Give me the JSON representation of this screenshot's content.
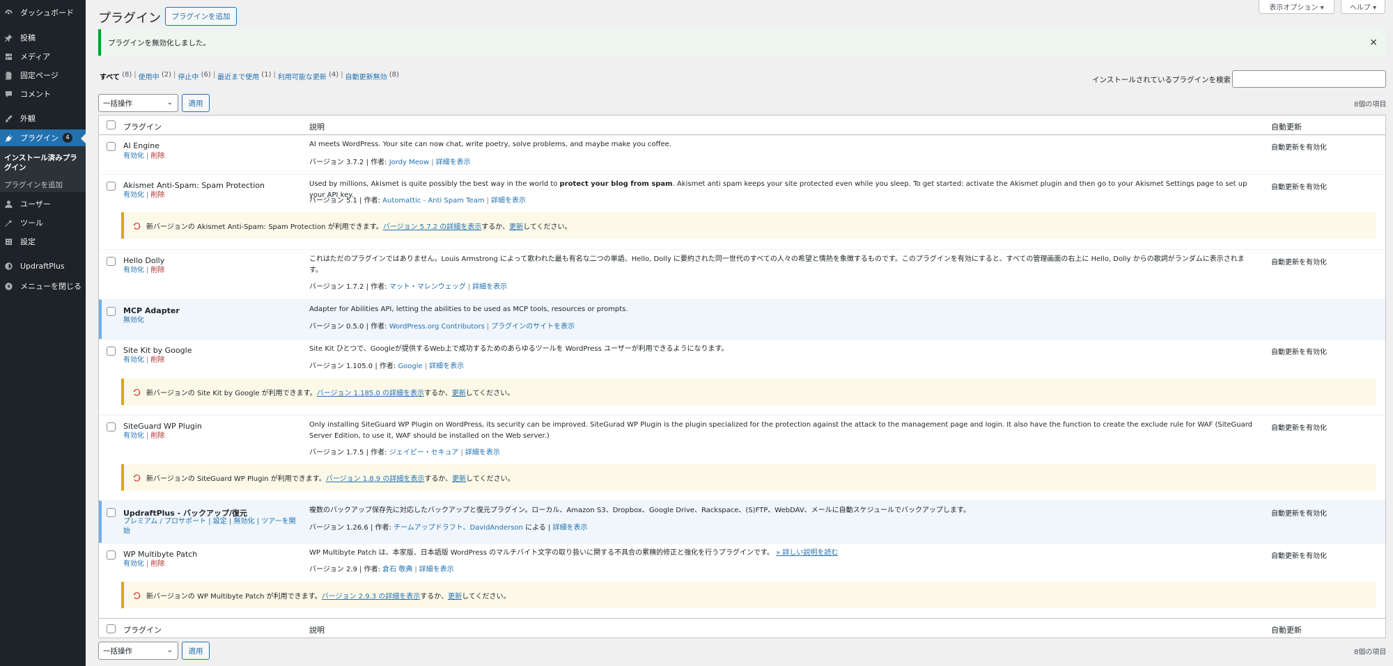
{
  "sidebar": {
    "items": [
      {
        "label": "ダッシュボード",
        "icon": "dashboard-icon"
      },
      {
        "label": "投稿",
        "icon": "pin-icon"
      },
      {
        "label": "メディア",
        "icon": "media-icon"
      },
      {
        "label": "固定ページ",
        "icon": "page-icon"
      },
      {
        "label": "コメント",
        "icon": "comment-icon"
      },
      {
        "label": "外観",
        "icon": "brush-icon"
      },
      {
        "label": "プラグイン",
        "icon": "plugin-icon",
        "badge": "4"
      },
      {
        "label": "ユーザー",
        "icon": "user-icon"
      },
      {
        "label": "ツール",
        "icon": "wrench-icon"
      },
      {
        "label": "設定",
        "icon": "settings-icon"
      },
      {
        "label": "UpdraftPlus",
        "icon": "updraft-icon"
      },
      {
        "label": "メニューを閉じる",
        "icon": "collapse-icon"
      }
    ],
    "submenu": {
      "installed": "インストール済みプラグイン",
      "add_new": "プラグインを追加"
    }
  },
  "header": {
    "title": "プラグイン",
    "add_button": "プラグインを追加",
    "screen_options": "表示オプション ▾",
    "help": "ヘルプ ▾"
  },
  "notice": {
    "text": "プラグインを無効化しました。",
    "dismiss": "×"
  },
  "filters": [
    {
      "label": "すべて",
      "count": "(8)"
    },
    {
      "label": "使用中",
      "count": "(2)"
    },
    {
      "label": "停止中",
      "count": "(6)"
    },
    {
      "label": "最近まで使用",
      "count": "(1)"
    },
    {
      "label": "利用可能な更新",
      "count": "(4)"
    },
    {
      "label": "自動更新無効",
      "count": "(8)"
    }
  ],
  "search": {
    "label": "インストールされているプラグインを検索",
    "value": ""
  },
  "bulk": {
    "select": "一括操作",
    "apply": "適用",
    "items_count": "8個の項目"
  },
  "table": {
    "columns": {
      "plugin": "プラグイン",
      "description": "説明",
      "auto_update": "自動更新"
    },
    "rows": [
      {
        "name": "AI Engine",
        "actions": [
          "有効化",
          "削除"
        ],
        "description": "AI meets WordPress. Your site can now chat, write poetry, solve problems, and maybe make you coffee.",
        "version": "バージョン 3.7.2 | 作者: ",
        "author": "Jordy Meow",
        "details": "詳細を表示",
        "auto": "自動更新を有効化"
      },
      {
        "name": "Akismet Anti-Spam: Spam Protection",
        "actions": [
          "有効化",
          "削除"
        ],
        "description_pre": "Used by millions, Akismet is quite possibly the best way in the world to ",
        "description_bold": "protect your blog from spam",
        "description_post": ". Akismet anti spam keeps your site protected even while you sleep. To get started: activate the Akismet plugin and then go to your Akismet Settings page to set up your API key.",
        "version": "バージョン 5.1 | 作者: ",
        "author": "Automattic - Anti Spam Team",
        "details": "詳細を表示",
        "auto": "自動更新を有効化",
        "update_pre": "新バージョンの Akismet Anti-Spam: Spam Protection が利用できます。",
        "update_link": "バージョン 5.7.2 の詳細を表示",
        "update_mid": "するか、",
        "update_now": "更新",
        "update_post": "してください。"
      },
      {
        "name": "Hello Dolly",
        "actions": [
          "有効化",
          "削除"
        ],
        "description": "これはただのプラグインではありません。Louis Armstrong によって歌われた最も有名な二つの単語、Hello, Dolly に要約された同一世代のすべての人々の希望と情熱を象徴するものです。このプラグインを有効にすると、すべての管理画面の右上に Hello, Dolly からの歌詞がランダムに表示されます。",
        "version": "バージョン 1.7.2 | 作者: ",
        "author": "マット・マレンウェッグ",
        "details": "詳細を表示",
        "auto": "自動更新を有効化"
      },
      {
        "name": "MCP Adapter",
        "actions": [
          "無効化"
        ],
        "description": "Adapter for Abilities API, letting the abilities to be used as MCP tools, resources or prompts.",
        "version": "バージョン 0.5.0 | 作者: ",
        "author": "WordPress.org Contributors",
        "details": "プラグインのサイトを表示"
      },
      {
        "name": "Site Kit by Google",
        "actions": [
          "有効化",
          "削除"
        ],
        "description": "Site Kit ひとつで、Googleが提供するWeb上で成功するためのあらゆるツールを WordPress ユーザーが利用できるようになります。",
        "version": "バージョン 1.105.0 | 作者: ",
        "author": "Google",
        "details": "詳細を表示",
        "auto": "自動更新を有効化",
        "update_pre": "新バージョンの Site Kit by Google が利用できます。",
        "update_link": "バージョン 1.185.0 の詳細を表示",
        "update_mid": "するか、",
        "update_now": "更新",
        "update_post": "してください。"
      },
      {
        "name": "SiteGuard WP Plugin",
        "actions": [
          "有効化",
          "削除"
        ],
        "description": "Only installing SiteGuard WP Plugin on WordPress, its security can be improved. SiteGurad WP Plugin is the plugin specialized for the protection against the attack to the management page and login. It also have the function to create the exclude rule for WAF (SiteGuard Server Edition, to use it, WAF should be installed on the Web server.)",
        "version": "バージョン 1.7.5 | 作者: ",
        "author": "ジェイピー・セキュア",
        "details": "詳細を表示",
        "auto": "自動更新を有効化",
        "update_pre": "新バージョンの SiteGuard WP Plugin が利用できます。",
        "update_link": "バージョン 1.8.9 の詳細を表示",
        "update_mid": "するか、",
        "update_now": "更新",
        "update_post": "してください。"
      },
      {
        "name": "UpdraftPlus - バックアップ/復元",
        "actions_line1": "プレミアム / プロサポート | 設定 | 無効化 | ツアーを開",
        "actions_line2": "始",
        "description": "複数のバックアップ保存先に対応したバックアップと復元プラグイン。ローカル、Amazon S3、Dropbox、Google Drive、Rackspace、(S)FTP、WebDAV、メールに自動スケジュールでバックアップします。",
        "version": "バージョン 1.26.6 | 作者: ",
        "author": "チームアップドラフト、DavidAnderson",
        "author_post": " による | ",
        "details": "詳細を表示",
        "auto": "自動更新を有効化"
      },
      {
        "name": "WP Multibyte Patch",
        "actions": [
          "有効化",
          "削除"
        ],
        "description": "WP Multibyte Patch は、本家版、日本語版 WordPress のマルチバイト文字の取り扱いに関する不具合の累積的修正と強化を行うプラグインです。",
        "description_link": "» 詳しい説明を読む",
        "version": "バージョン 2.9 | 作者: ",
        "author": "倉石 敬典",
        "details": "詳細を表示",
        "auto": "自動更新を有効化",
        "update_pre": "新バージョンの WP Multibyte Patch が利用できます。",
        "update_link": "バージョン 2.9.3 の詳細を表示",
        "update_mid": "するか、",
        "update_now": "更新",
        "update_post": "してください。"
      }
    ]
  },
  "colors": {
    "accent": "#2271b1",
    "sidebar": "#1d2327",
    "update_border": "#dba617",
    "notice_border": "#00a32a",
    "delete": "#b32d2e"
  }
}
